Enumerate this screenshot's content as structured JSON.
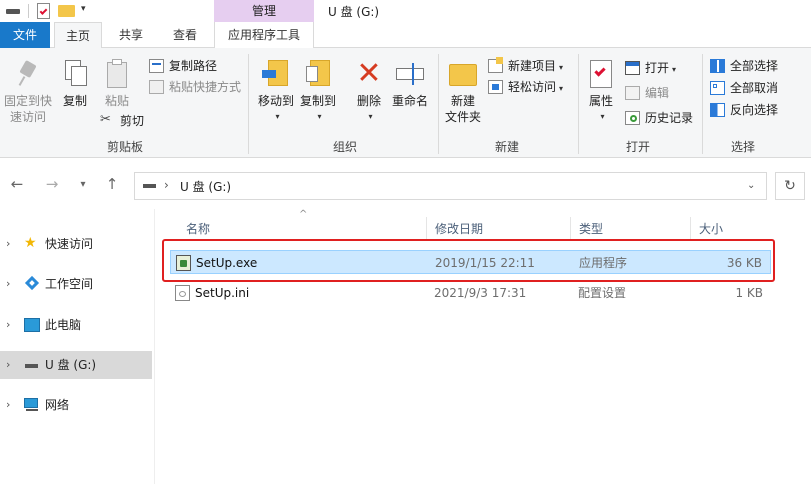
{
  "titlebar": {
    "manage_tab": "管理",
    "window_title": "U 盘 (G:)"
  },
  "tabs": {
    "file": "文件",
    "home": "主页",
    "share": "共享",
    "view": "查看",
    "app_tools": "应用程序工具"
  },
  "ribbon": {
    "clipboard": {
      "group_label": "剪贴板",
      "pin_line1": "固定到快",
      "pin_line2": "速访问",
      "copy": "复制",
      "paste": "粘贴",
      "copy_path": "复制路径",
      "paste_shortcut": "粘贴快捷方式",
      "cut": "剪切"
    },
    "organize": {
      "group_label": "组织",
      "move_to": "移动到",
      "copy_to": "复制到",
      "delete": "删除",
      "rename": "重命名"
    },
    "new": {
      "group_label": "新建",
      "new_folder_line1": "新建",
      "new_folder_line2": "文件夹",
      "new_item": "新建项目",
      "easy_access": "轻松访问"
    },
    "open": {
      "group_label": "打开",
      "properties": "属性",
      "open": "打开",
      "edit": "编辑",
      "history": "历史记录"
    },
    "select": {
      "group_label": "选择",
      "select_all": "全部选择",
      "select_none": "全部取消",
      "invert": "反向选择"
    }
  },
  "address": {
    "path_drive": "U 盘 (G:)"
  },
  "navpane": {
    "items": [
      {
        "label": "快速访问"
      },
      {
        "label": "工作空间"
      },
      {
        "label": "此电脑"
      },
      {
        "label": "U 盘 (G:)"
      },
      {
        "label": "网络"
      }
    ]
  },
  "filelist": {
    "columns": {
      "name": "名称",
      "date": "修改日期",
      "type": "类型",
      "size": "大小"
    },
    "rows": [
      {
        "name": "SetUp.exe",
        "date": "2019/1/15 22:11",
        "type": "应用程序",
        "size": "36 KB"
      },
      {
        "name": "SetUp.ini",
        "date": "2021/9/3 17:31",
        "type": "配置设置",
        "size": "1 KB"
      }
    ]
  },
  "colors": {
    "file_tab": "#1979ca",
    "manage_tab": "#e6cef0",
    "selected_row": "#cce8ff",
    "highlight_box": "#e02020"
  }
}
